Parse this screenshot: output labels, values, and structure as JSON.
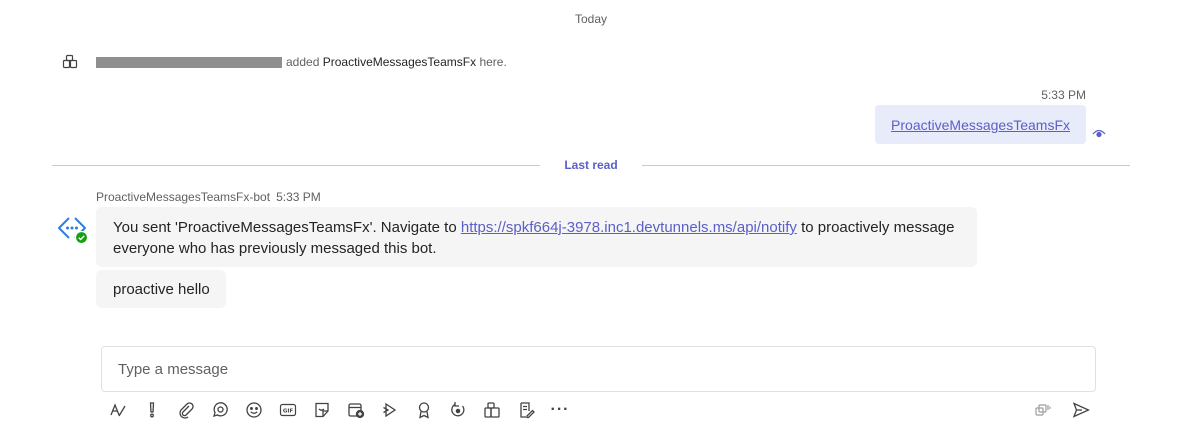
{
  "date_divider": "Today",
  "system_message": {
    "icon": "app-icon",
    "text_before": "added",
    "app_name": "ProactiveMessagesTeamsFx",
    "text_after": "here."
  },
  "sent_message": {
    "time": "5:33 PM",
    "text": "ProactiveMessagesTeamsFx",
    "status_icon": "seen-eye-icon"
  },
  "last_read_label": "Last read",
  "bot_message": {
    "sender": "ProactiveMessagesTeamsFx-bot",
    "time": "5:33 PM",
    "part1": "You sent 'ProactiveMessagesTeamsFx'. Navigate to",
    "link": "https://spkf664j-3978.inc1.devtunnels.ms/api/notify",
    "part2": "to proactively message everyone who has previously messaged this bot.",
    "second_message": "proactive hello"
  },
  "composer": {
    "placeholder": "Type a message",
    "tools": [
      "format-icon",
      "priority-icon",
      "attach-icon",
      "loop-icon",
      "emoji-icon",
      "gif-icon",
      "sticker-icon",
      "schedule-meeting-icon",
      "stream-icon",
      "praise-icon",
      "loop-update-icon",
      "apps-icon",
      "approvals-icon"
    ],
    "more_label": "···",
    "right_tools": [
      "copilot-icon",
      "send-icon"
    ]
  },
  "colors": {
    "accent": "#5b5fc7",
    "sent_bubble": "#e8ebfa",
    "received_bubble": "#f5f5f5",
    "presence": "#13a10e"
  }
}
